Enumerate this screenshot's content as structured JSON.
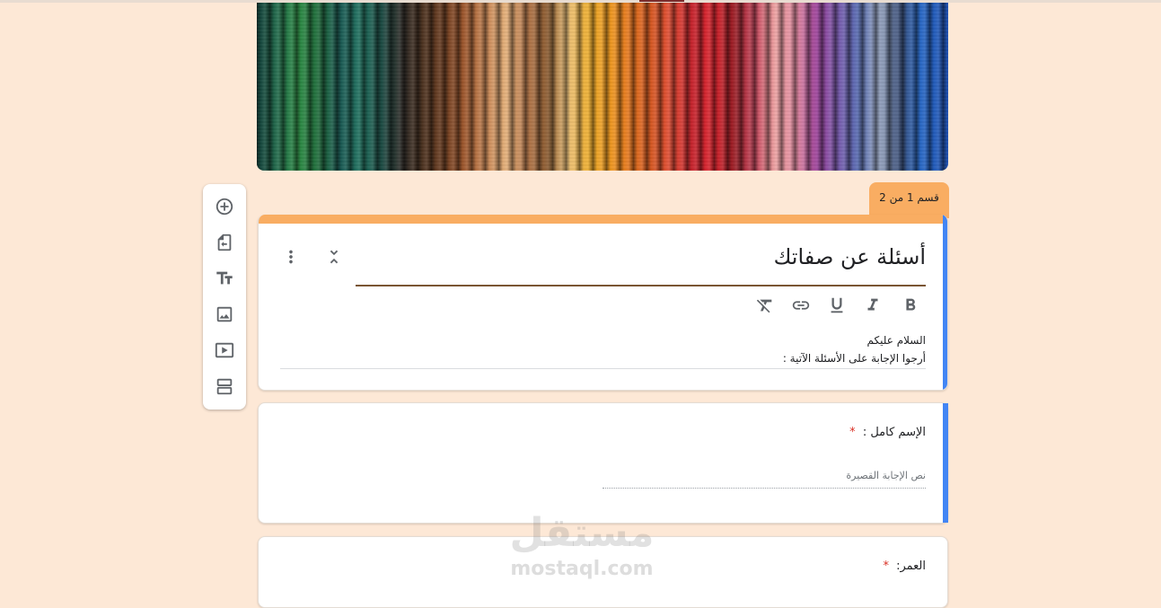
{
  "section_tab": {
    "label": "قسم 1 من 2"
  },
  "form": {
    "title": "أسئلة عن صفاتك",
    "description_lines": [
      "السلام عليكم",
      "أرجوا الإجابة على الأسئلة الآتية :"
    ]
  },
  "formatting_toolbar": [
    "bold-icon",
    "italic-icon",
    "underline-icon",
    "link-icon",
    "clear-formatting-icon"
  ],
  "side_toolbar": [
    "add-question-icon",
    "import-questions-icon",
    "add-title-icon",
    "add-image-icon",
    "add-video-icon",
    "add-section-icon"
  ],
  "questions": [
    {
      "label": "الإسم كامل :",
      "required_mark": "*",
      "placeholder": "نص الإجابة القصيرة"
    },
    {
      "label": "العمر:",
      "required_mark": "*"
    }
  ],
  "watermark": {
    "arabic": "مستقل",
    "latin": "mostaql.com"
  },
  "colors": {
    "page_bg": "#fde8d6",
    "accent": "#f9ad62",
    "active_bar": "#4285f4",
    "required": "#d93025"
  }
}
